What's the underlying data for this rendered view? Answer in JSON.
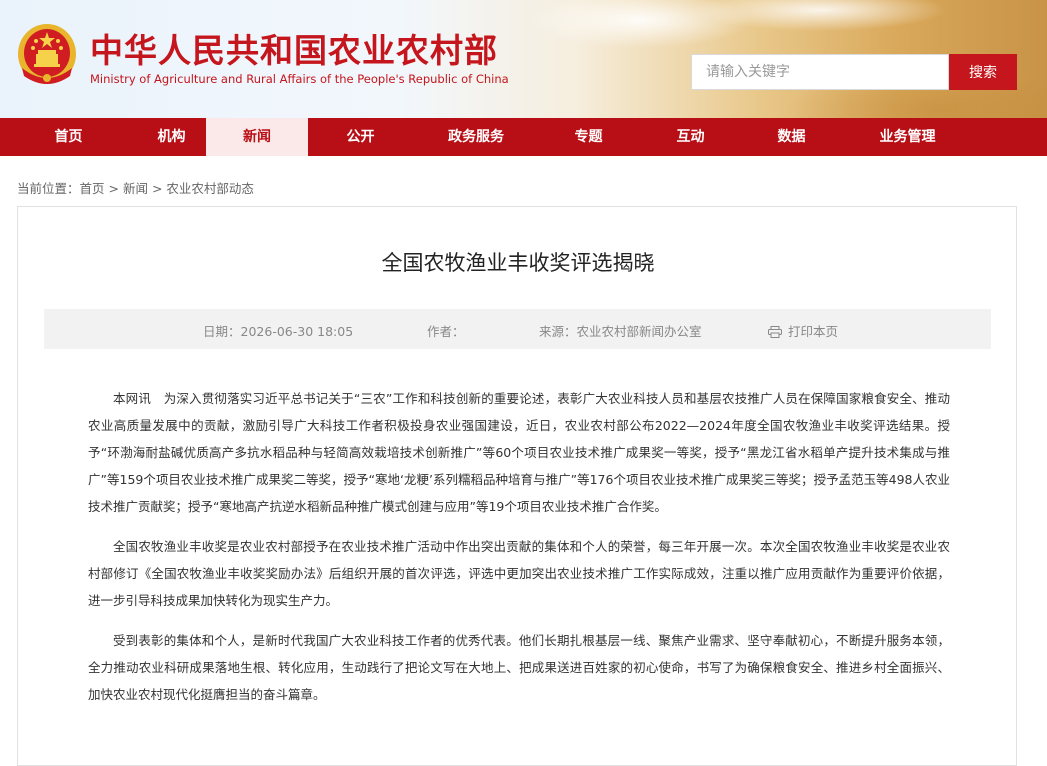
{
  "site": {
    "title_cn": "中华人民共和国农业农村部",
    "title_en": "Ministry of Agriculture and Rural Affairs of the People's Republic of China",
    "emblem_icon": "national-emblem-icon"
  },
  "search": {
    "placeholder": "请输入关键字",
    "button_label": "搜索"
  },
  "nav": {
    "items": [
      {
        "label": "首页"
      },
      {
        "label": "机构"
      },
      {
        "label": "新闻"
      },
      {
        "label": "公开"
      },
      {
        "label": "政务服务"
      },
      {
        "label": "专题"
      },
      {
        "label": "互动"
      },
      {
        "label": "数据"
      },
      {
        "label": "业务管理"
      }
    ],
    "active": "新闻"
  },
  "breadcrumb": {
    "prefix": "当前位置：",
    "items": [
      "首页",
      "新闻",
      "农业农村部动态"
    ],
    "separator": " > "
  },
  "article": {
    "title": "全国农牧渔业丰收奖评选揭晓",
    "meta": {
      "date_label": "日期：",
      "date": "2026-06-30 18:05",
      "author_label": "作者：",
      "author": "",
      "source_label": "来源：",
      "source": "农业农村部新闻办公室",
      "print_label": "打印本页"
    },
    "paragraphs": [
      "本网讯　为深入贯彻落实习近平总书记关于“三农”工作和科技创新的重要论述，表彰广大农业科技人员和基层农技推广人员在保障国家粮食安全、推动农业高质量发展中的贡献，激励引导广大科技工作者积极投身农业强国建设，近日，农业农村部公布2022—2024年度全国农牧渔业丰收奖评选结果。授予“环渤海耐盐碱优质高产多抗水稻品种与轻简高效栽培技术创新推广”等60个项目农业技术推广成果奖一等奖，授予“黑龙江省水稻单产提升技术集成与推广”等159个项目农业技术推广成果奖二等奖，授予“寒地‘龙粳’系列糯稻品种培育与推广”等176个项目农业技术推广成果奖三等奖；授予孟范玉等498人农业技术推广贡献奖；授予“寒地高产抗逆水稻新品种推广模式创建与应用”等19个项目农业技术推广合作奖。",
      "全国农牧渔业丰收奖是农业农村部授予在农业技术推广活动中作出突出贡献的集体和个人的荣誉，每三年开展一次。本次全国农牧渔业丰收奖是农业农村部修订《全国农牧渔业丰收奖奖励办法》后组织开展的首次评选，评选中更加突出农业技术推广工作实际成效，注重以推广应用贡献作为重要评价依据，进一步引导科技成果加快转化为现实生产力。",
      "受到表彰的集体和个人，是新时代我国广大农业科技工作者的优秀代表。他们长期扎根基层一线、聚焦产业需求、坚守奉献初心，不断提升服务本领，全力推动农业科研成果落地生根、转化应用，生动践行了把论文写在大地上、把成果送进百姓家的初心使命，书写了为确保粮食安全、推进乡村全面振兴、加快农业农村现代化挺膺担当的奋斗篇章。"
    ]
  },
  "colors": {
    "brand_red": "#c4161c",
    "nav_red": "#b80f16",
    "active_tab_bg": "#fbe9e9"
  }
}
